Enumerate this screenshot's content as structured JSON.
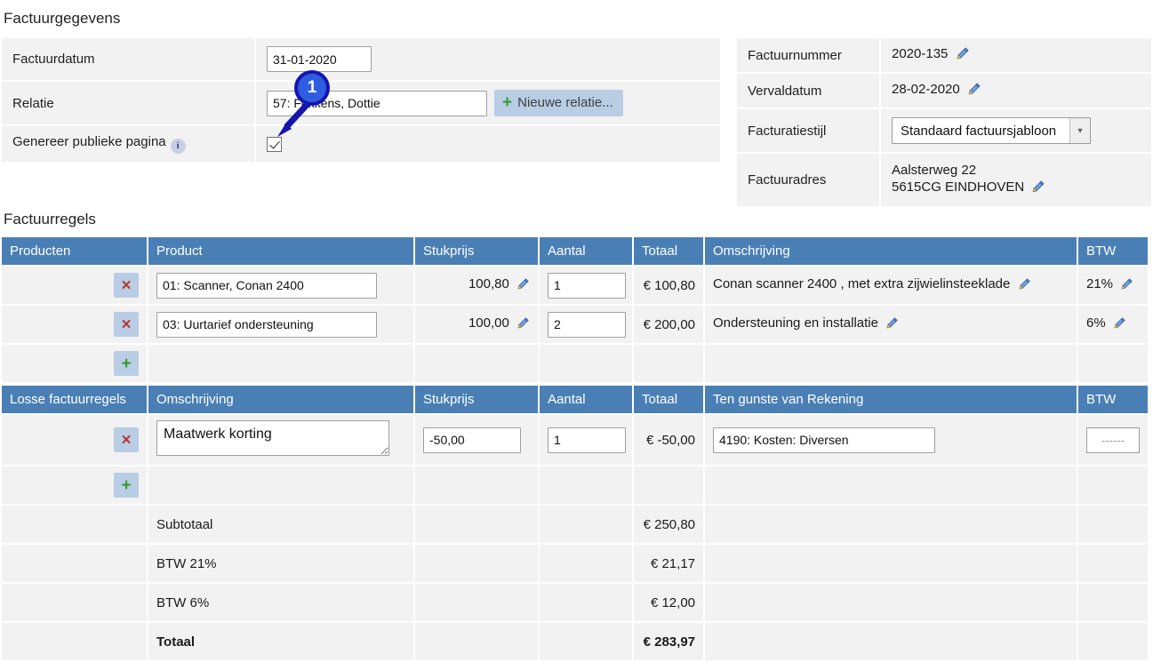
{
  "headings": {
    "invoice_details": "Factuurgegevens",
    "invoice_lines": "Factuurregels"
  },
  "form_left": {
    "rows": [
      {
        "label": "Factuurdatum",
        "value": "31-01-2020"
      },
      {
        "label": "Relatie",
        "value": "57: Fokkens, Dottie"
      },
      {
        "label": "Genereer publieke pagina"
      }
    ],
    "new_relation_button": "Nieuwe relatie...",
    "new_relation_plus": "+",
    "info_icon_glyph": "i",
    "public_page_checked": true
  },
  "form_right": {
    "rows": [
      {
        "label": "Factuurnummer",
        "value": "2020-135",
        "editable": true
      },
      {
        "label": "Vervaldatum",
        "value": "28-02-2020",
        "editable": true
      },
      {
        "label": "Facturatiestijl",
        "value": "Standaard factuursjabloon",
        "type": "select"
      },
      {
        "label": "Factuuradres",
        "value_line1": "Aalsterweg 22",
        "value_line2": "5615CG EINDHOVEN",
        "editable": true
      }
    ]
  },
  "products_table": {
    "headers": [
      "Producten",
      "Product",
      "Stukprijs",
      "Aantal",
      "Totaal",
      "Omschrijving",
      "BTW"
    ],
    "rows": [
      {
        "delete_label": "×",
        "product": "01: Scanner, Conan 2400",
        "unit_price": "100,80",
        "quantity": "1",
        "total": "€ 100,80",
        "description": "Conan scanner 2400 , met extra zijwielinsteeklade",
        "vat": "21%"
      },
      {
        "delete_label": "×",
        "product": "03: Uurtarief ondersteuning",
        "unit_price": "100,00",
        "quantity": "2",
        "total": "€ 200,00",
        "description": "Ondersteuning en installatie",
        "vat": "6%"
      }
    ],
    "add_label": "+"
  },
  "loose_lines_table": {
    "headers": [
      "Losse factuurregels",
      "Omschrijving",
      "Stukprijs",
      "Aantal",
      "Totaal",
      "Ten gunste van Rekening",
      "BTW"
    ],
    "rows": [
      {
        "delete_label": "×",
        "description": "Maatwerk korting",
        "unit_price": "-50,00",
        "quantity": "1",
        "total": "€ -50,00",
        "account": "4190: Kosten: Diversen",
        "vat": "------"
      }
    ],
    "add_label": "+"
  },
  "totals": [
    {
      "label": "Subtotaal",
      "amount": "€ 250,80",
      "bold": false
    },
    {
      "label": "BTW 21%",
      "amount": "€ 21,17",
      "bold": false
    },
    {
      "label": "BTW 6%",
      "amount": "€ 12,00",
      "bold": false
    },
    {
      "label": "Totaal",
      "amount": "€ 283,97",
      "bold": true
    }
  ],
  "callout": {
    "number": "1",
    "fill_color": "#2f5de0",
    "ring_color": "#1515b0"
  },
  "colors": {
    "table_header_blue": "#4a7fb5",
    "cell_gray": "#f2f2f2",
    "button_light_blue": "#b9cde4",
    "delete_red": "#b33b35",
    "add_green": "#2f9e2f",
    "pencil_blue": "#4472c4"
  }
}
